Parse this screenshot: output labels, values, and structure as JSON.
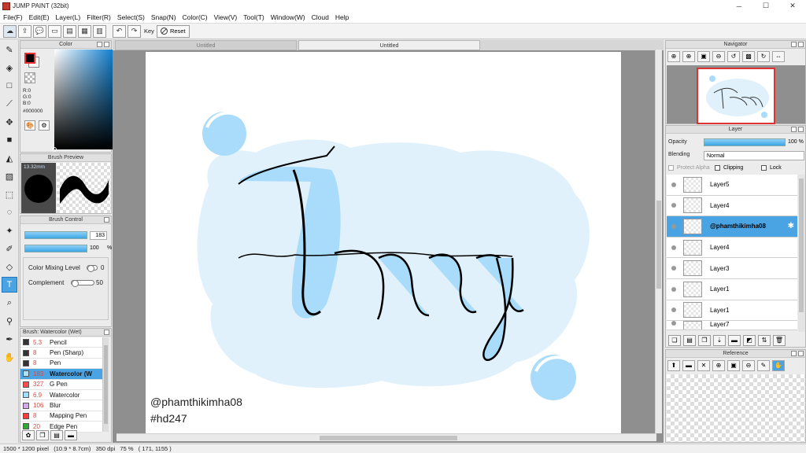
{
  "window": {
    "title": "JUMP PAINT (32bit)",
    "minimize": "─",
    "maximize": "☐",
    "close": "✕"
  },
  "menu": [
    "File(F)",
    "Edit(E)",
    "Layer(L)",
    "Filter(R)",
    "Select(S)",
    "Snap(N)",
    "Color(C)",
    "View(V)",
    "Tool(T)",
    "Window(W)",
    "Cloud",
    "Help"
  ],
  "toolbar": {
    "key_label": "Key",
    "reset_label": "Reset"
  },
  "color_panel": {
    "title": "Color",
    "r": "R:0",
    "g": "G:0",
    "b": "B:0",
    "hex": "#000000",
    "fg_color": "#000000"
  },
  "brush_preview": {
    "title": "Brush Preview",
    "size": "13.32mm"
  },
  "brush_control": {
    "title": "Brush Control",
    "size_value": "183",
    "opacity_value": "100",
    "opacity_unit": "%",
    "mixing_label": "Color Mixing Level",
    "mixing_value": "0",
    "complement_label": "Complement",
    "complement_value": "50"
  },
  "brush_list": {
    "title": "Brush: Watercolor (Wet)",
    "items": [
      {
        "size": "5.3",
        "name": "Pencil",
        "color": "#333333"
      },
      {
        "size": "8",
        "name": "Pen (Sharp)",
        "color": "#333333"
      },
      {
        "size": "8",
        "name": "Pen",
        "color": "#333333"
      },
      {
        "size": "183",
        "name": "Watercolor (W",
        "color": "#aee0ff"
      },
      {
        "size": "327",
        "name": "G Pen",
        "color": "#ff4d4d"
      },
      {
        "size": "6.9",
        "name": "Watercolor",
        "color": "#9ee0ff"
      },
      {
        "size": "106",
        "name": "Blur",
        "color": "#d9a8e8"
      },
      {
        "size": "8",
        "name": "Mapping Pen",
        "color": "#ff3b3b"
      },
      {
        "size": "20",
        "name": "Edge Pen",
        "color": "#33aa33"
      }
    ]
  },
  "canvas": {
    "tabs": [
      "Untitled",
      "Untitled"
    ],
    "handle_tag": "@phamthikimha08",
    "hashtag": "#hd247",
    "art_text": "Tracy"
  },
  "navigator": {
    "title": "Navigator"
  },
  "layer_panel": {
    "title": "Layer",
    "opacity_label": "Opacity",
    "opacity_value": "100 %",
    "blending_label": "Blending",
    "blending_value": "Normal",
    "protect_alpha": "Protect Alpha",
    "clipping": "Clipping",
    "lock": "Lock",
    "layers": [
      "Layer5",
      "Layer4",
      "@phamthikimha08",
      "Layer4",
      "Layer3",
      "Layer1",
      "Layer1",
      "Layer7"
    ]
  },
  "reference": {
    "title": "Reference"
  },
  "status": "1500 * 1200 pixel   (10.9 * 8.7cm)   350 dpi   75 %   ( 171, 1155 )"
}
